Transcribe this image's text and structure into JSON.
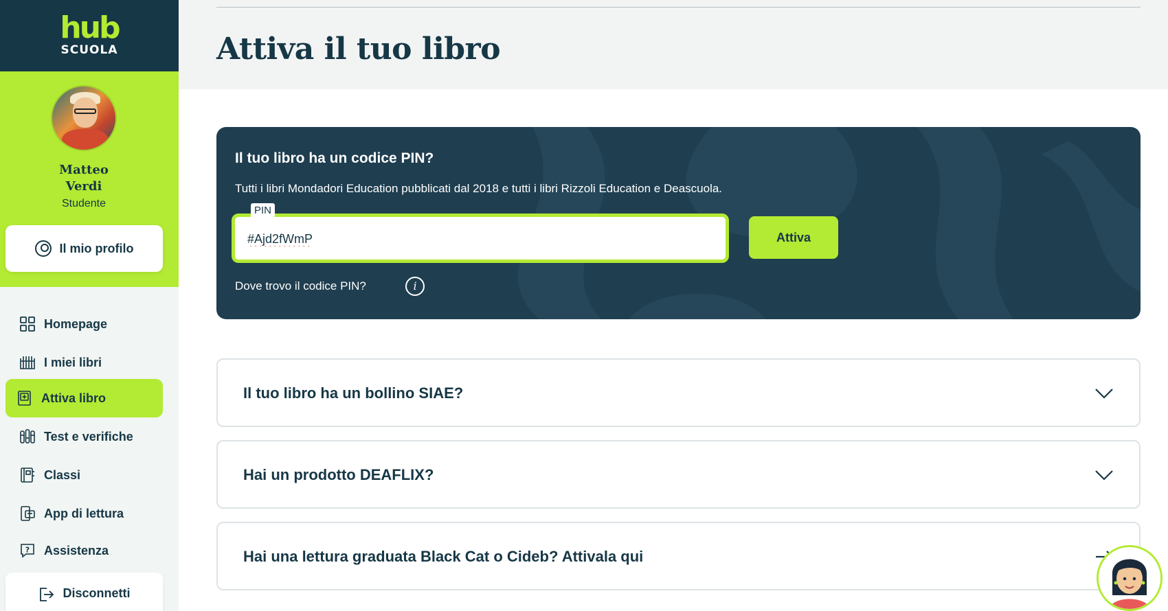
{
  "brand": {
    "logo_main": "hub",
    "logo_sub": "SCUOLA"
  },
  "profile": {
    "first_name": "Matteo",
    "last_name": "Verdi",
    "role": "Studente",
    "profile_button": "Il mio profilo"
  },
  "nav": {
    "items": [
      {
        "label": "Homepage",
        "icon": "grid-icon"
      },
      {
        "label": "I miei libri",
        "icon": "books-icon"
      },
      {
        "label": "Attiva libro",
        "icon": "activate-book-icon",
        "active": true
      },
      {
        "label": "Test e verifiche",
        "icon": "tests-icon"
      },
      {
        "label": "Classi",
        "icon": "classes-icon"
      },
      {
        "label": "App di lettura",
        "icon": "reading-app-icon"
      },
      {
        "label": "Assistenza",
        "icon": "help-icon"
      }
    ],
    "logout": "Disconnetti"
  },
  "main": {
    "title": "Attiva il tuo libro",
    "pin_card": {
      "title": "Il tuo libro ha un codice PIN?",
      "description": "Tutti i libri Mondadori Education pubblicati dal 2018 e tutti i libri Rizzoli Education e Deascuola.",
      "field_label": "PIN",
      "field_value": "#Ajd2fWmP",
      "submit": "Attiva",
      "help_link": "Dove trovo il codice PIN?"
    },
    "accordions": [
      {
        "label": "Il tuo libro ha un bollino SIAE?",
        "icon": "chevron-down-icon"
      },
      {
        "label": "Hai un prodotto DEAFLIX?",
        "icon": "chevron-down-icon"
      },
      {
        "label": "Hai una lettura graduata Black Cat o Cideb? Attivala qui",
        "icon": "arrow-right-icon"
      }
    ]
  },
  "colors": {
    "navy": "#163746",
    "lime": "#b3ea33",
    "card_bg": "#1f3e50",
    "sidebar_bg": "#f1f5f3"
  }
}
